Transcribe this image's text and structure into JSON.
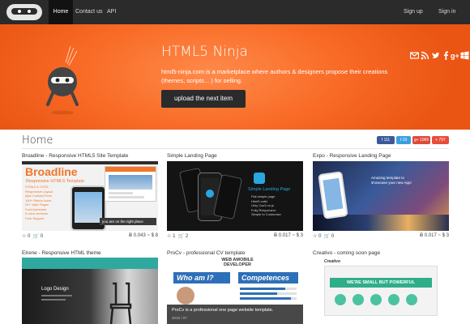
{
  "nav": {
    "items": [
      "Home",
      "Contact us",
      "API"
    ],
    "signup": "Sign up",
    "signin": "Sign in"
  },
  "social_icons": [
    "mail-icon",
    "rss-icon",
    "twitter-icon",
    "facebook-icon",
    "google-plus-icon",
    "windows-icon"
  ],
  "hero": {
    "title": "HTML5 Ninja",
    "text": "html5-ninja.com is a marketplace where authors & designers propose their creations (themes, scripts... ) for selling.",
    "button": "upload the next item"
  },
  "page_title": "Home",
  "share": {
    "facebook": "111",
    "twitter": "19",
    "google": "1066",
    "other": "797"
  },
  "cards": [
    {
      "title": "Broadline - Responsive HTML5 Site Template",
      "stars": "0",
      "carts": "0",
      "price": "0.043 ~ $ 8",
      "thumb": {
        "logo": "Broadline",
        "sub": "Responsive HTML5 Template",
        "features": [
          "HTML5 & CSS3",
          "Responsive Layout",
          "Ajax Contact Form",
          "100+ Retina Icons",
          "20+ Valid Pages",
          "Font Awesome",
          "5 color versions",
          "Free Support"
        ],
        "banner": "you are on the right place"
      }
    },
    {
      "title": "Simple Landing Page",
      "stars": "1",
      "carts": "2",
      "price": "0.017 ~ $ 3",
      "thumb": {
        "heading": "Simple Landing Page",
        "lines": [
          "Flat simple page",
          "Html5 valid",
          "Only Css3 no js",
          "Fully Responsive",
          "Simple to Customize"
        ]
      }
    },
    {
      "title": "Expo - Responsive Landing Page",
      "stars": "0",
      "carts": "0",
      "price": "0.017 ~ $ 3",
      "thumb": {
        "caption": "Amazing template to showcase your new App!"
      }
    },
    {
      "title": "Elrene - Responsive HTML theme",
      "thumb": {
        "heading": "Logo Design"
      }
    },
    {
      "title": "ProCv - professional CV template",
      "thumb": {
        "header": "WEB AMOBILE DEVELOPER",
        "who": "Who am I?",
        "comp": "Competences"
      },
      "tooltip": {
        "text": "ProCv is a professional one page website template.",
        "date": "2015 / 07"
      }
    },
    {
      "title": "Creativo - coming soon page",
      "thumb": {
        "logo": "Creativo",
        "banner": "WE'RE SMALL BUT POWERFUL"
      }
    }
  ],
  "colors": {
    "navbar": "#2b2b2b",
    "hero": "#f86a25",
    "facebook": "#3b5998",
    "twitter": "#3a9fe0",
    "google": "#dd4b39",
    "other": "#e74c3c"
  }
}
